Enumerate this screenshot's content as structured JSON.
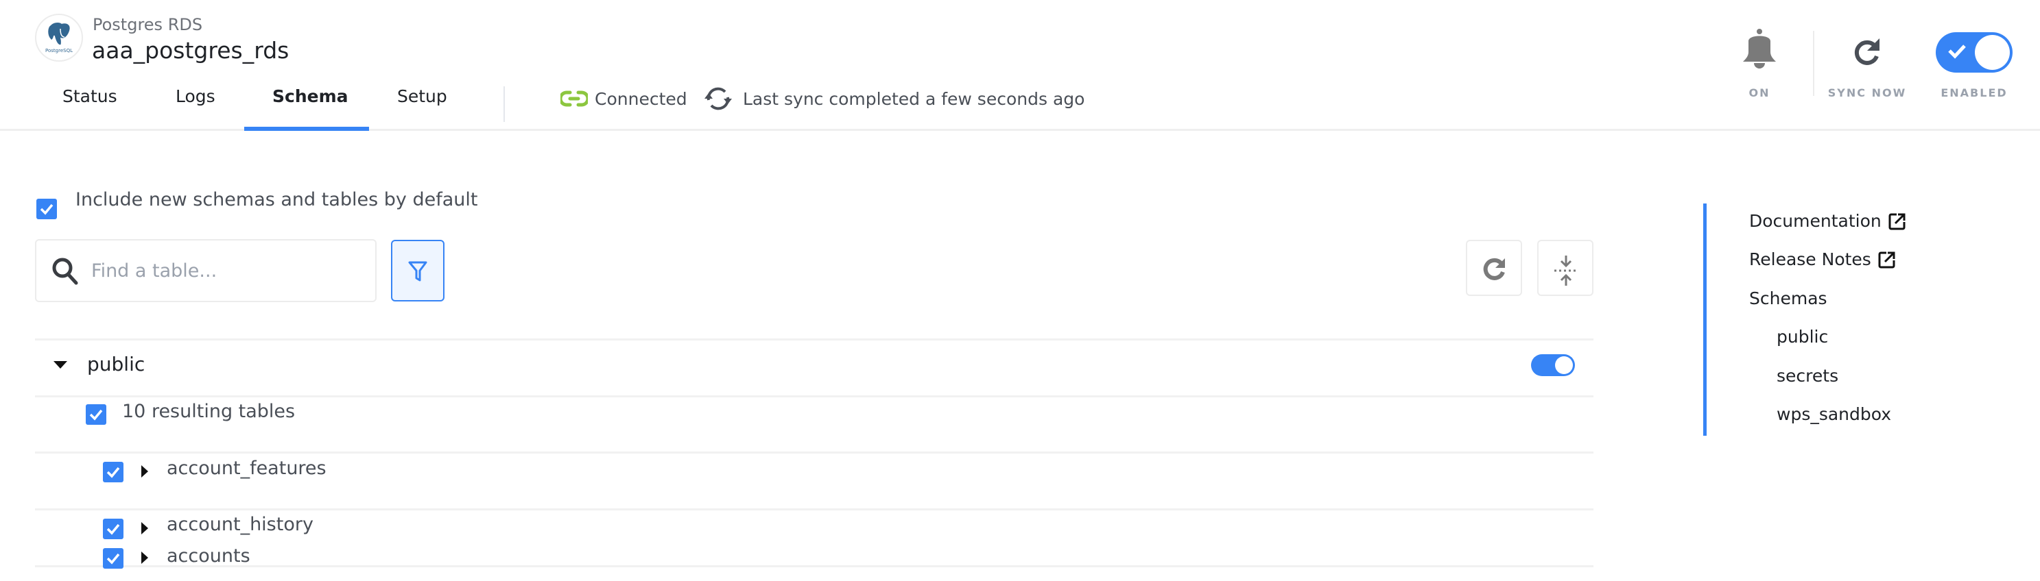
{
  "header": {
    "connector_type": "Postgres RDS",
    "connector_name": "aaa_postgres_rds",
    "logo_label": "PostgreSQL",
    "tabs": [
      {
        "label": "Status",
        "active": false
      },
      {
        "label": "Logs",
        "active": false
      },
      {
        "label": "Schema",
        "active": true
      },
      {
        "label": "Setup",
        "active": false
      }
    ],
    "connection_status": "Connected",
    "sync_status": "Last sync completed a few seconds ago",
    "actions": {
      "notifications_label": "ON",
      "sync_now_label": "SYNC NOW",
      "enabled_label": "ENABLED",
      "enabled": true
    }
  },
  "schema": {
    "include_new_label": "Include new schemas and tables by default",
    "include_new_checked": true,
    "search": {
      "placeholder": "Find a table...",
      "value": ""
    },
    "schemas": [
      {
        "name": "public",
        "expanded": true,
        "enabled": true,
        "resulting_tables_label": "10 resulting tables",
        "tables": [
          {
            "name": "account_features",
            "checked": true
          },
          {
            "name": "account_history",
            "checked": true
          },
          {
            "name": "accounts",
            "checked": true
          }
        ]
      }
    ]
  },
  "right_nav": {
    "links": [
      {
        "label": "Documentation",
        "external": true
      },
      {
        "label": "Release Notes",
        "external": true
      }
    ],
    "schemas_label": "Schemas",
    "schemas": [
      "public",
      "secrets",
      "wps_sandbox"
    ]
  },
  "colors": {
    "accent": "#3784f5",
    "connected": "#8cc63f",
    "muted_label": "#9aa1ac"
  }
}
